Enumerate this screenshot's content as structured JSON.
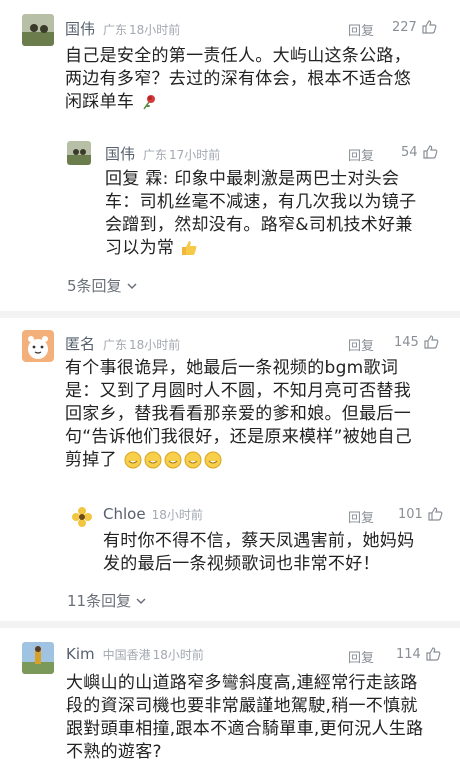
{
  "comments": [
    {
      "user": "国伟",
      "location": "广东",
      "time": "18小时前",
      "reply_label": "回复",
      "likes": "227",
      "text": "自己是安全的第一责任人。大屿山这条公路，两边有多窄？去过的深有体会，根本不适合悠闲踩单车",
      "emoji": "rose-icon"
    },
    {
      "user": "国伟",
      "location": "广东",
      "time": "17小时前",
      "reply_label": "回复",
      "likes": "54",
      "text": "回复 霖: 印象中最刺激是两巴士对头会车：司机丝毫不减速，有几次我以为镜子会蹭到，然却没有。路窄&司机技术好兼习以为常",
      "emoji": "thumbs-up-icon",
      "more": "5条回复"
    },
    {
      "user": "匿名",
      "location": "广东",
      "time": "18小时前",
      "reply_label": "回复",
      "likes": "145",
      "text": "有个事很诡异，她最后一条视频的bgm歌词是：又到了月圆时人不圆，不知月亮可否替我回家乡，替我看看那亲爱的爹和娘。但最后一句“告诉他们我很好，还是原来模样”被她自己剪掉了",
      "emoji": "face-icon"
    },
    {
      "user": "Chloe",
      "time": "18小时前",
      "reply_label": "回复",
      "likes": "101",
      "text": "有时你不得不信，蔡天凤遇害前，她妈妈发的最后一条视频歌词也非常不好！",
      "more": "11条回复"
    },
    {
      "user": "Kim",
      "location": "中国香港",
      "time": "18小时前",
      "reply_label": "回复",
      "likes": "114",
      "text": "大嶼山的山道路窄多彎斜度高,連經常行走該路段的資深司機也要非常嚴謹地駕駛,稍一不慎就跟對頭車相撞,跟本不適合騎單車,更何況人生路不熟的遊客?"
    }
  ],
  "colors": {
    "name": "#56606e",
    "meta": "#a3a8b0",
    "divider": "#f3f3f3"
  }
}
